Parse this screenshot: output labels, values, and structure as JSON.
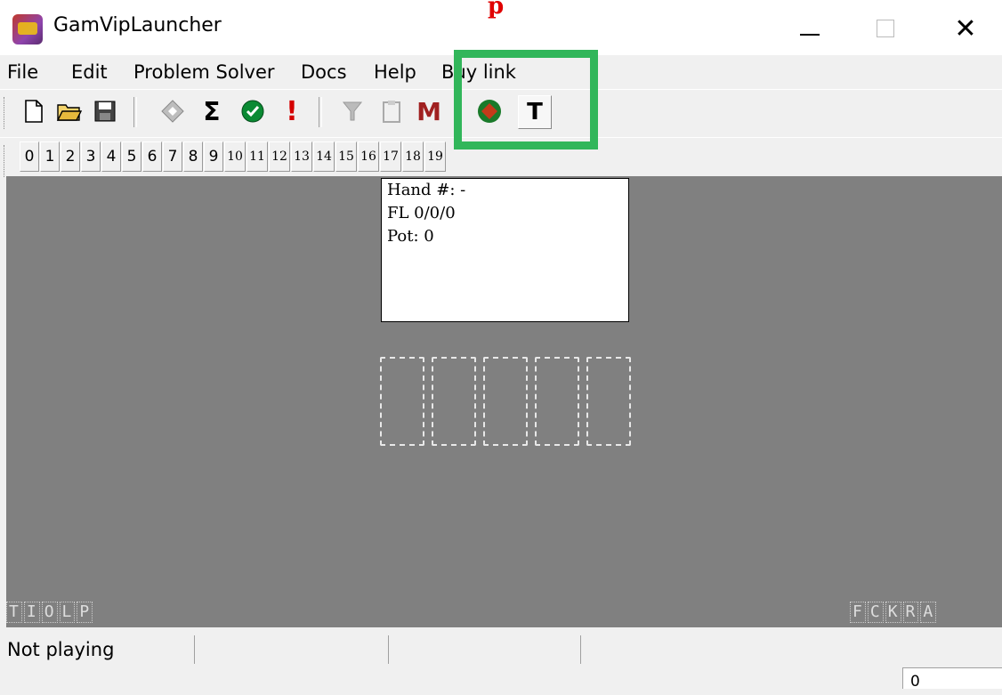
{
  "window": {
    "title": "GamVipLauncher",
    "red_mark": "p",
    "close_glyph": "✕"
  },
  "menu": {
    "items": [
      "File",
      "Edit",
      "Problem Solver",
      "Docs",
      "Help",
      "Buy link"
    ]
  },
  "toolbar": {
    "buttons": [
      {
        "icon": "new-file-icon"
      },
      {
        "icon": "open-folder-icon"
      },
      {
        "icon": "save-icon"
      },
      {
        "icon": "diamond-icon"
      },
      {
        "icon": "sigma-icon",
        "glyph": "Σ"
      },
      {
        "icon": "check-icon"
      },
      {
        "icon": "exclamation-icon",
        "glyph": "!"
      },
      {
        "icon": "filter-icon"
      },
      {
        "icon": "clipboard-icon"
      },
      {
        "icon": "m-icon",
        "glyph": "M"
      },
      {
        "icon": "stop-icon"
      },
      {
        "icon": "text-icon",
        "glyph": "T"
      }
    ]
  },
  "seat_buttons": [
    "0",
    "1",
    "2",
    "3",
    "4",
    "5",
    "6",
    "7",
    "8",
    "9",
    "10",
    "11",
    "12",
    "13",
    "14",
    "15",
    "16",
    "17",
    "18",
    "19"
  ],
  "hand_info": {
    "hand": "Hand #: -",
    "limit": "FL 0/0/0",
    "pot": "Pot: 0"
  },
  "labels": {
    "left": [
      "T",
      "I",
      "O",
      "L",
      "P"
    ],
    "right": [
      "F",
      "C",
      "K",
      "R",
      "A"
    ]
  },
  "status": {
    "text": "Not playing",
    "counter": "0"
  },
  "colors": {
    "table": "#808080",
    "annotation": "#31b65a",
    "red_mark": "#e00000"
  }
}
